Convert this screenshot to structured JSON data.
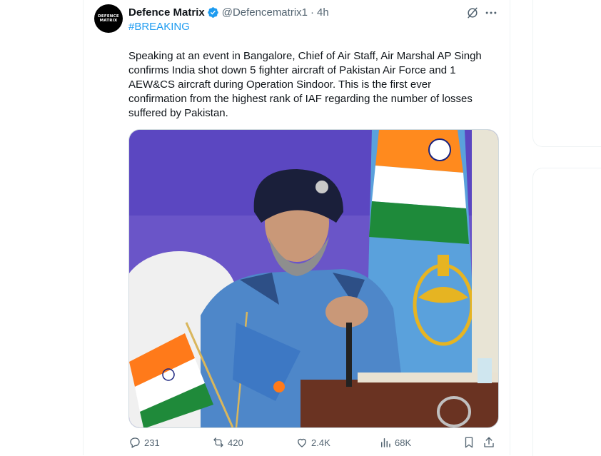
{
  "tweet": {
    "author_name": "Defence Matrix",
    "handle": "@Defencematrix1",
    "separator": "·",
    "time": "4h",
    "hashtag": "#BREAKING",
    "avatar_text": "DEFENCE MATRIX",
    "text": "Speaking at an event in Bangalore, Chief of Air Staff, Air Marshal AP Singh\nconfirms India shot down 5 fighter aircraft of Pakistan Air Force and 1\nAEW&CS aircraft during Operation Sindoor. This is the first ever\nconfirmation from the highest rank of IAF regarding the number of losses\nsuffered by Pakistan.",
    "media": {
      "description_icon": "photo"
    }
  },
  "actions": {
    "replies": "231",
    "reposts": "420",
    "likes": "2.4K",
    "views": "68K"
  },
  "icons": {
    "verified": "verified-badge-icon",
    "grok": "grok-icon",
    "more": "more-icon",
    "reply": "reply-icon",
    "repost": "repost-icon",
    "like": "like-icon",
    "views": "views-icon",
    "bookmark": "bookmark-icon",
    "share": "share-icon"
  },
  "colors": {
    "accent": "#1d9bf0",
    "secondary_text": "#536471",
    "primary_text": "#0f1419",
    "border": "#eff3f4"
  }
}
